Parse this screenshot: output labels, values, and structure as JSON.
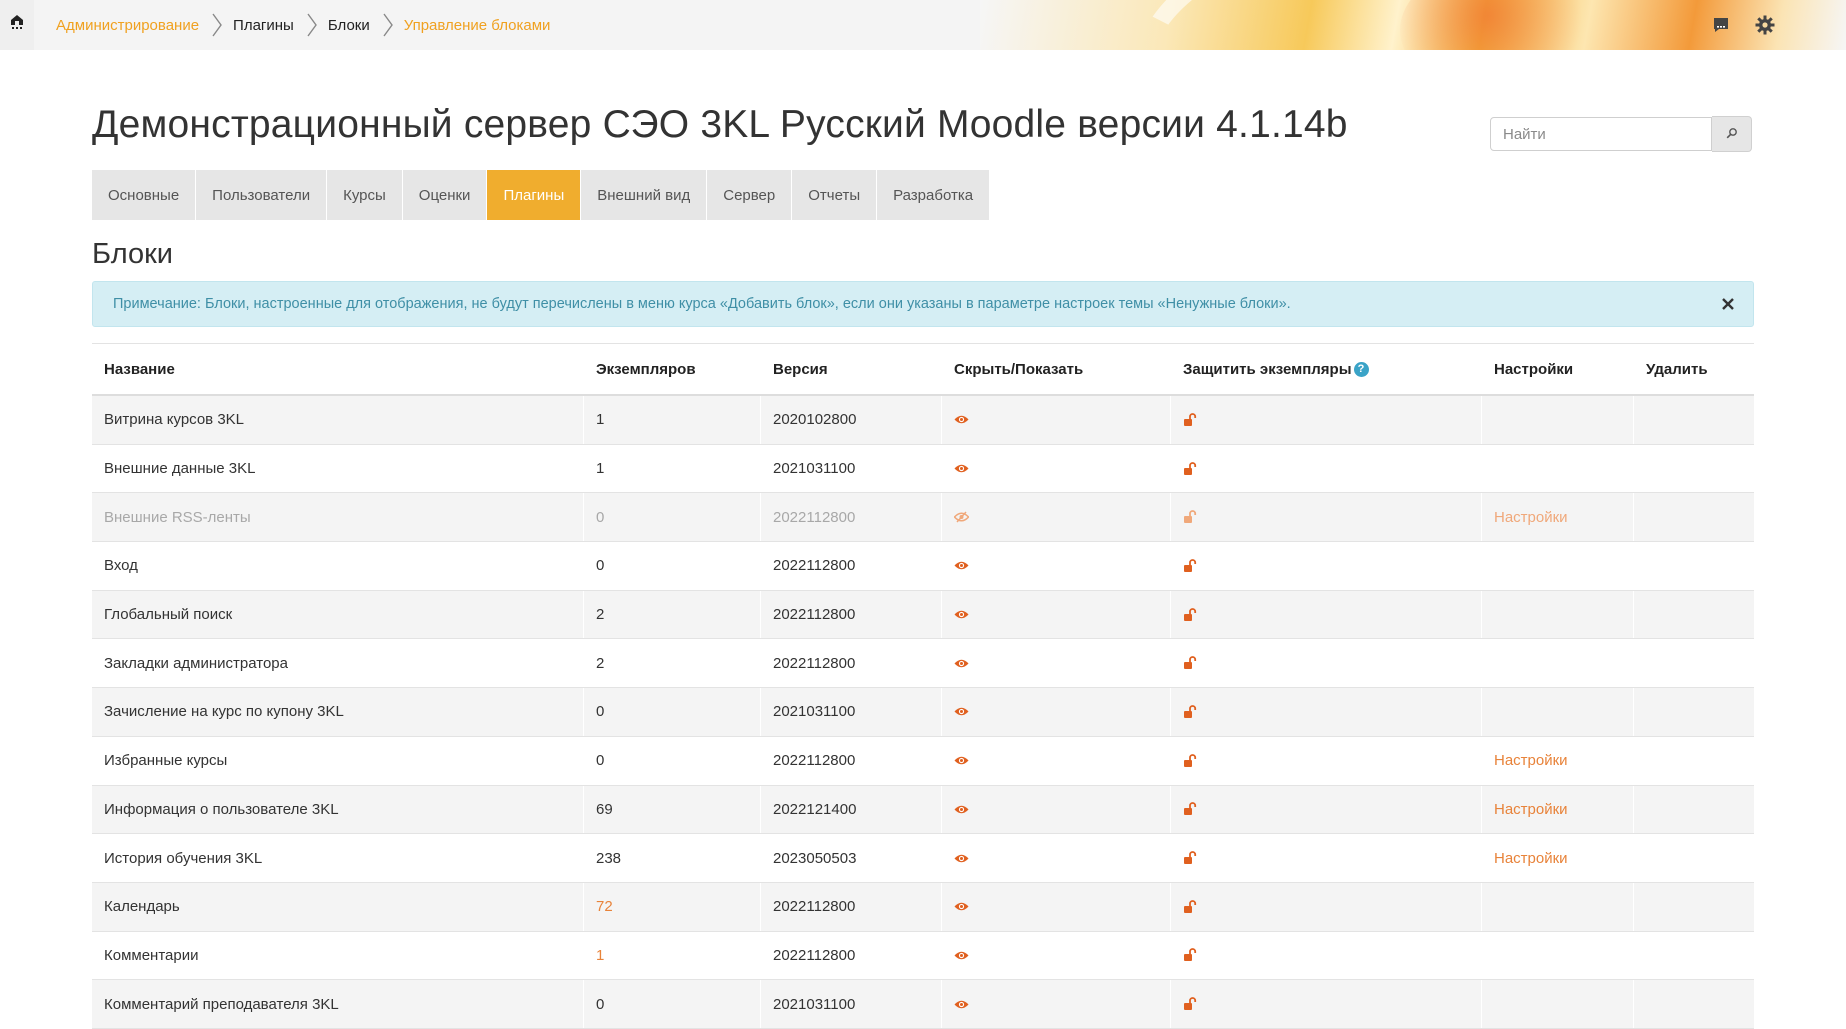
{
  "breadcrumb": {
    "items": [
      {
        "label": "Администрирование",
        "type": "link"
      },
      {
        "label": "Плагины",
        "type": "text"
      },
      {
        "label": "Блоки",
        "type": "text"
      },
      {
        "label": "Управление блоками",
        "type": "link"
      }
    ]
  },
  "header": {
    "title": "Демонстрационный сервер СЭО 3KL Русский Moodle версии 4.1.14b",
    "search_placeholder": "Найти"
  },
  "tabs": [
    {
      "label": "Основные",
      "active": false
    },
    {
      "label": "Пользователи",
      "active": false
    },
    {
      "label": "Курсы",
      "active": false
    },
    {
      "label": "Оценки",
      "active": false
    },
    {
      "label": "Плагины",
      "active": true
    },
    {
      "label": "Внешний вид",
      "active": false
    },
    {
      "label": "Сервер",
      "active": false
    },
    {
      "label": "Отчеты",
      "active": false
    },
    {
      "label": "Разработка",
      "active": false
    }
  ],
  "section_title": "Блоки",
  "alert": {
    "text": "Примечание: Блоки, настроенные для отображения, не будут перечислены в меню курса «Добавить блок», если они указаны в параметре настроек темы «Ненужные блоки»."
  },
  "table": {
    "columns": [
      "Название",
      "Экземпляров",
      "Версия",
      "Скрыть/Показать",
      "Защитить экземпляры",
      "Настройки",
      "Удалить"
    ],
    "rows": [
      {
        "name": "Витрина курсов 3KL",
        "instances": "1",
        "instances_link": false,
        "version": "2020102800",
        "hidden": false,
        "settings": ""
      },
      {
        "name": "Внешние данные 3KL",
        "instances": "1",
        "instances_link": false,
        "version": "2021031100",
        "hidden": false,
        "settings": ""
      },
      {
        "name": "Внешние RSS-ленты",
        "instances": "0",
        "instances_link": false,
        "version": "2022112800",
        "hidden": true,
        "settings": "Настройки"
      },
      {
        "name": "Вход",
        "instances": "0",
        "instances_link": false,
        "version": "2022112800",
        "hidden": false,
        "settings": ""
      },
      {
        "name": "Глобальный поиск",
        "instances": "2",
        "instances_link": false,
        "version": "2022112800",
        "hidden": false,
        "settings": ""
      },
      {
        "name": "Закладки администратора",
        "instances": "2",
        "instances_link": false,
        "version": "2022112800",
        "hidden": false,
        "settings": ""
      },
      {
        "name": "Зачисление на курс по купону 3KL",
        "instances": "0",
        "instances_link": false,
        "version": "2021031100",
        "hidden": false,
        "settings": ""
      },
      {
        "name": "Избранные курсы",
        "instances": "0",
        "instances_link": false,
        "version": "2022112800",
        "hidden": false,
        "settings": "Настройки"
      },
      {
        "name": "Информация о пользователе 3KL",
        "instances": "69",
        "instances_link": false,
        "version": "2022121400",
        "hidden": false,
        "settings": "Настройки"
      },
      {
        "name": "История обучения 3KL",
        "instances": "238",
        "instances_link": false,
        "version": "2023050503",
        "hidden": false,
        "settings": "Настройки"
      },
      {
        "name": "Календарь",
        "instances": "72",
        "instances_link": true,
        "version": "2022112800",
        "hidden": false,
        "settings": ""
      },
      {
        "name": "Комментарии",
        "instances": "1",
        "instances_link": true,
        "version": "2022112800",
        "hidden": false,
        "settings": ""
      },
      {
        "name": "Комментарий преподавателя 3KL",
        "instances": "0",
        "instances_link": false,
        "version": "2021031100",
        "hidden": false,
        "settings": ""
      }
    ]
  },
  "colors": {
    "accent": "#f0ad2e",
    "link": "#e8833a",
    "icon": "#e0601f",
    "alert_bg": "#d5eef4",
    "alert_text": "#3f8fa6"
  },
  "icons": {
    "home": "home-icon",
    "messages": "message-icon",
    "settings": "gear-icon",
    "search": "search-icon",
    "close": "close-icon",
    "show": "eye-icon",
    "hidden": "eye-slash-icon",
    "unlock": "unlock-icon",
    "help": "help-icon"
  }
}
